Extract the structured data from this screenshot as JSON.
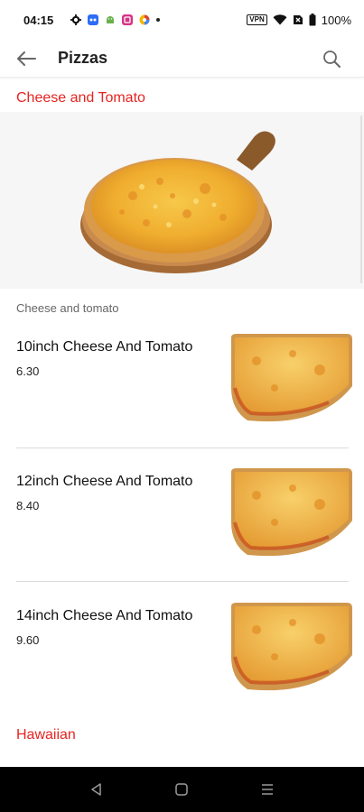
{
  "status_bar": {
    "time": "04:15",
    "battery": "100%",
    "vpn": "VPN",
    "icons": [
      "settings-icon",
      "app-icon-blue",
      "android-icon",
      "app-icon-pink",
      "app-icon-multicolor",
      "notification-dot",
      "vpn-icon",
      "wifi-icon",
      "sim-icon",
      "battery-icon"
    ]
  },
  "app_bar": {
    "title": "Pizzas",
    "back_icon": "arrow-left-icon",
    "search_icon": "search-icon"
  },
  "sections": [
    {
      "title": "Cheese and Tomato",
      "description": "Cheese and tomato",
      "items": [
        {
          "name": "10inch Cheese And Tomato",
          "price": "6.30"
        },
        {
          "name": "12inch Cheese And Tomato",
          "price": "8.40"
        },
        {
          "name": "14inch Cheese And Tomato",
          "price": "9.60"
        }
      ]
    },
    {
      "title": "Hawaiian"
    }
  ],
  "nav_bar": {
    "icons": [
      "back-triangle-icon",
      "home-square-icon",
      "recents-menu-icon"
    ]
  },
  "colors": {
    "accent": "#e52421",
    "text": "#111111",
    "secondary_text": "#666666",
    "nav_background": "#000000"
  }
}
